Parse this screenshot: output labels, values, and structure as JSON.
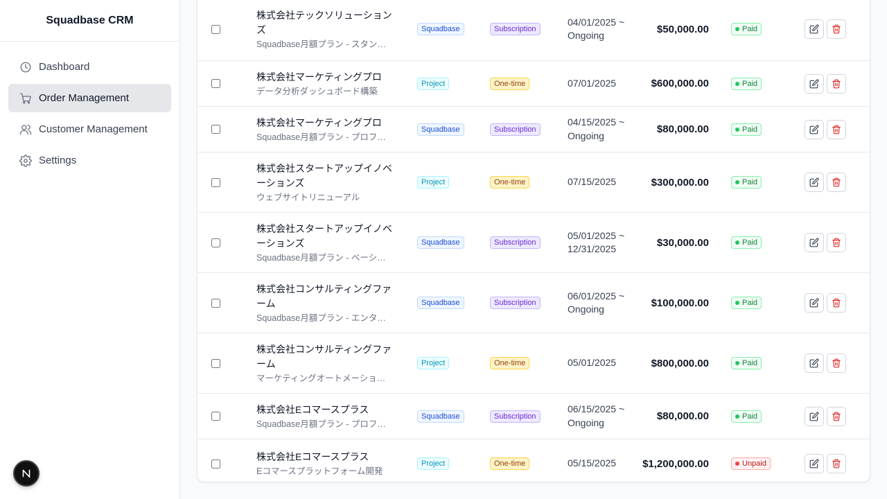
{
  "app": {
    "title": "Squadbase CRM"
  },
  "sidebar": {
    "items": [
      {
        "label": "Dashboard",
        "icon": "clock-icon",
        "active": false
      },
      {
        "label": "Order Management",
        "icon": "cart-icon",
        "active": true
      },
      {
        "label": "Customer Management",
        "icon": "users-icon",
        "active": false
      },
      {
        "label": "Settings",
        "icon": "gear-icon",
        "active": false
      }
    ]
  },
  "colors": {
    "accent_active_bg": "#e5e7eb",
    "paid": "#22c55e",
    "unpaid": "#ef4444",
    "delete": "#dc2626"
  },
  "orders": [
    {
      "customer": "株式会社テックソリューションズ",
      "product": "Squadbase月額プラン - スタンダ...",
      "type": "Squadbase",
      "billing": "Subscription",
      "period": "04/01/2025 ~ Ongoing",
      "amount": "$50,000.00",
      "status": "Paid"
    },
    {
      "customer": "株式会社マーケティングプロ",
      "product": "データ分析ダッシュボード構築",
      "type": "Project",
      "billing": "One-time",
      "period": "07/01/2025",
      "amount": "$600,000.00",
      "status": "Paid"
    },
    {
      "customer": "株式会社マーケティングプロ",
      "product": "Squadbase月額プラン - プロフェ...",
      "type": "Squadbase",
      "billing": "Subscription",
      "period": "04/15/2025 ~ Ongoing",
      "amount": "$80,000.00",
      "status": "Paid"
    },
    {
      "customer": "株式会社スタートアップイノベーションズ",
      "product": "ウェブサイトリニューアル",
      "type": "Project",
      "billing": "One-time",
      "period": "07/15/2025",
      "amount": "$300,000.00",
      "status": "Paid"
    },
    {
      "customer": "株式会社スタートアップイノベーションズ",
      "product": "Squadbase月額プラン - ベーシック",
      "type": "Squadbase",
      "billing": "Subscription",
      "period": "05/01/2025 ~ 12/31/2025",
      "amount": "$30,000.00",
      "status": "Paid"
    },
    {
      "customer": "株式会社コンサルティングファーム",
      "product": "Squadbase月額プラン - エンター...",
      "type": "Squadbase",
      "billing": "Subscription",
      "period": "06/01/2025 ~ Ongoing",
      "amount": "$100,000.00",
      "status": "Paid"
    },
    {
      "customer": "株式会社コンサルティングファーム",
      "product": "マーケティングオートメーション...",
      "type": "Project",
      "billing": "One-time",
      "period": "05/01/2025",
      "amount": "$800,000.00",
      "status": "Paid"
    },
    {
      "customer": "株式会社Eコマースプラス",
      "product": "Squadbase月額プラン - プロフェ...",
      "type": "Squadbase",
      "billing": "Subscription",
      "period": "06/15/2025 ~ Ongoing",
      "amount": "$80,000.00",
      "status": "Paid"
    },
    {
      "customer": "株式会社Eコマースプラス",
      "product": "Eコマースプラットフォーム開発",
      "type": "Project",
      "billing": "One-time",
      "period": "05/15/2025",
      "amount": "$1,200,000.00",
      "status": "Unpaid"
    }
  ]
}
